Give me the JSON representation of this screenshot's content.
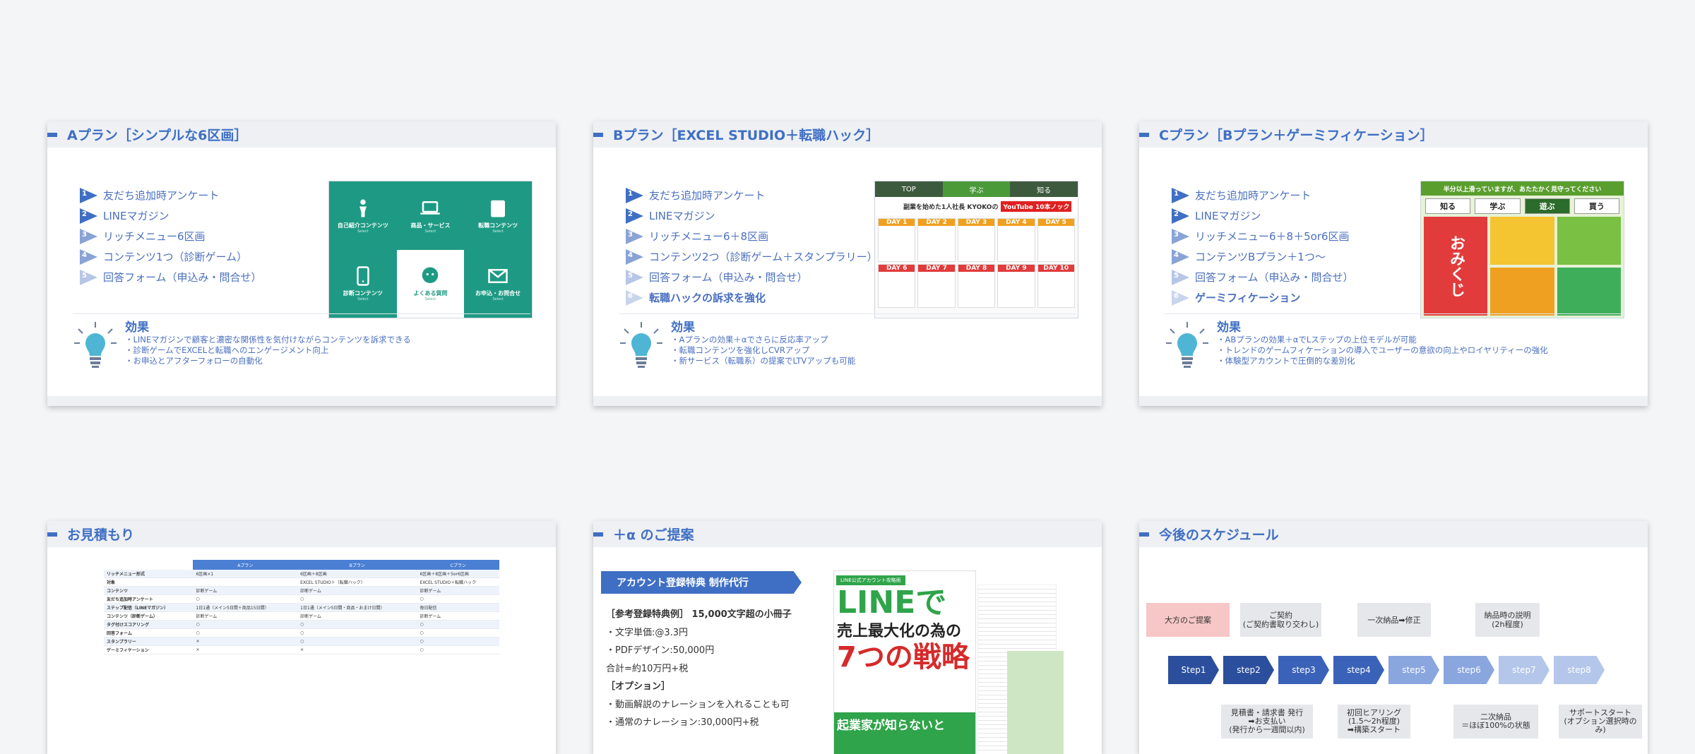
{
  "plan_a": {
    "title": "Aプラン［シンプルな6区画］",
    "items": [
      "友だち追加時アンケート",
      "LINEマガジン",
      "リッチメニュー6区画",
      "コンテンツ1つ（診断ゲーム）",
      "回答フォーム（申込み・問合せ）"
    ],
    "tiles": [
      {
        "label": "自己紹介コンテンツ",
        "sub": "Select",
        "icon": "person-icon"
      },
      {
        "label": "商品・サービス",
        "sub": "Select",
        "icon": "laptop-icon"
      },
      {
        "label": "転職コンテンツ",
        "sub": "Select",
        "icon": "badge-icon"
      },
      {
        "label": "診断コンテンツ",
        "sub": "Select",
        "icon": "phone-icon"
      },
      {
        "label": "よくある質問",
        "sub": "Select",
        "icon": "chat-icon"
      },
      {
        "label": "お申込・お問合せ",
        "sub": "Select",
        "icon": "mail-icon"
      }
    ],
    "effect_title": "効果",
    "effect_lines": [
      "・LINEマガジンで顧客と濃密な関係性を気付けながらコンテンツを訴求できる",
      "・診断ゲームでEXCELと転職へのエンゲージメント向上",
      "・お申込とアフターフォローの自動化"
    ]
  },
  "plan_b": {
    "title": "Bプラン［EXCEL STUDIO＋転職ハック］",
    "items": [
      "友だち追加時アンケート",
      "LINEマガジン",
      "リッチメニュー6＋8区画",
      "コンテンツ2つ（診断ゲーム＋スタンプラリー）",
      "回答フォーム（申込み・問合せ）",
      "転職ハックの訴求を強化"
    ],
    "banner": {
      "tabs": [
        "TOP",
        "学ぶ",
        "知る"
      ],
      "headline": "副業を始めた1人社長 KYOKOの",
      "yt": "YouTube 10本ノック",
      "days": [
        "DAY 1",
        "DAY 2",
        "DAY 3",
        "DAY 4",
        "DAY 5",
        "DAY 6",
        "DAY 7",
        "DAY 8",
        "DAY 9",
        "DAY 10"
      ]
    },
    "effect_title": "効果",
    "effect_lines": [
      "・Aプランの効果＋αでさらに反応率アップ",
      "・転職コンテンツを強化しCVRアップ",
      "・新サービス（転職系）の提案でLTVアップも可能"
    ]
  },
  "plan_c": {
    "title": "Cプラン［Bプラン＋ゲーミフィケーション］",
    "items": [
      "友だち追加時アンケート",
      "LINEマガジン",
      "リッチメニュー6＋8＋5or6区画",
      "コンテンツBプラン＋1つ〜",
      "回答フォーム（申込み・問合せ）",
      "ゲーミフィケーション"
    ],
    "banner": {
      "top": "半分以上滑っていますが、あたたかく見守ってください",
      "tabs": [
        "知る",
        "学ぶ",
        "遊ぶ",
        "買う"
      ],
      "omikuji": "おみくじ"
    },
    "effect_title": "効果",
    "effect_lines": [
      "・ABプランの効果＋αでLステップの上位モデルが可能",
      "・トレンドのゲームフィケーションの導入でユーザーの意欲の向上やロイヤリティーの強化",
      "・体験型アカウントで圧倒的な差別化"
    ]
  },
  "quote": {
    "title": "お見積もり",
    "headers": [
      "",
      "Aプラン",
      "Bプラン",
      "Cプラン"
    ],
    "rows": [
      [
        "リッチメニュー形式",
        "6区画×1",
        "6区画＋8区画",
        "6区画＋8区画＋5or6区画"
      ],
      [
        "対象",
        "",
        "EXCEL STUDIO＋（転職ハック）",
        "EXCEL STUDIO＋転職ハック"
      ],
      [
        "コンテンツ",
        "診断ゲーム",
        "診断ゲーム",
        "診断ゲーム"
      ],
      [
        "友だち追加時アンケート",
        "○",
        "○",
        "○"
      ],
      [
        "ステップ配信（LINEマガジン）",
        "1日1通（メイン5日間＋商品15日間）",
        "1日1通（メイン5日間・商品・おまけ日間）",
        "毎日配信"
      ],
      [
        "コンテンツ（診断ゲーム）",
        "診断ゲーム",
        "診断ゲーム",
        "診断ゲーム"
      ],
      [
        "タグ付けスコアリング",
        "○",
        "○",
        "○"
      ],
      [
        "回答フォーム",
        "○",
        "○",
        "○"
      ],
      [
        "スタンプラリー",
        "×",
        "○",
        "○"
      ],
      [
        "ゲーミフィケーション",
        "×",
        "×",
        "○"
      ]
    ]
  },
  "alpha": {
    "title": "＋α のご提案",
    "ribbon": "アカウント登録特典 制作代行",
    "lines": [
      "［参考登録特典例］ 15,000文字超の小冊子",
      "・文字単価:@3.3円",
      "・PDFデザイン:50,000円",
      "合計=約10万円+税",
      "［オプション］",
      "・動画解説のナレーションを入れることも可",
      "・通常のナレーション:30,000円+税"
    ],
    "book": {
      "badge": "LINE公式アカウント攻略術",
      "l1": "LINEで",
      "l2": "売上最大化の為の",
      "l3": "7つの戦略",
      "l4": "起業家が知らないと"
    }
  },
  "schedule": {
    "title": "今後のスケジュール",
    "top": [
      "大方のご提案",
      "ご契約\n(ご契約書取り交わし)",
      "一次納品➡修正",
      "納品時の説明\n(2h程度)"
    ],
    "steps": [
      "Step1",
      "step2",
      "step3",
      "step4",
      "step5",
      "step6",
      "step7",
      "step8"
    ],
    "bottom": [
      "見積書・請求書 発行\n➡お支払い\n(発行から一週間以内)",
      "初回ヒアリング\n(1.5〜2h程度)\n➡構築スタート",
      "二次納品\n＝ほぼ100%の状態",
      "サポートスタート\n(オプション選択時のみ)"
    ]
  },
  "colors": {
    "accent": "#3f6fc4",
    "teal": "#1e9a84",
    "step_dark": "#2b4f9c",
    "step_light": "#9fb6e6",
    "pink": "#f7c6c6"
  }
}
